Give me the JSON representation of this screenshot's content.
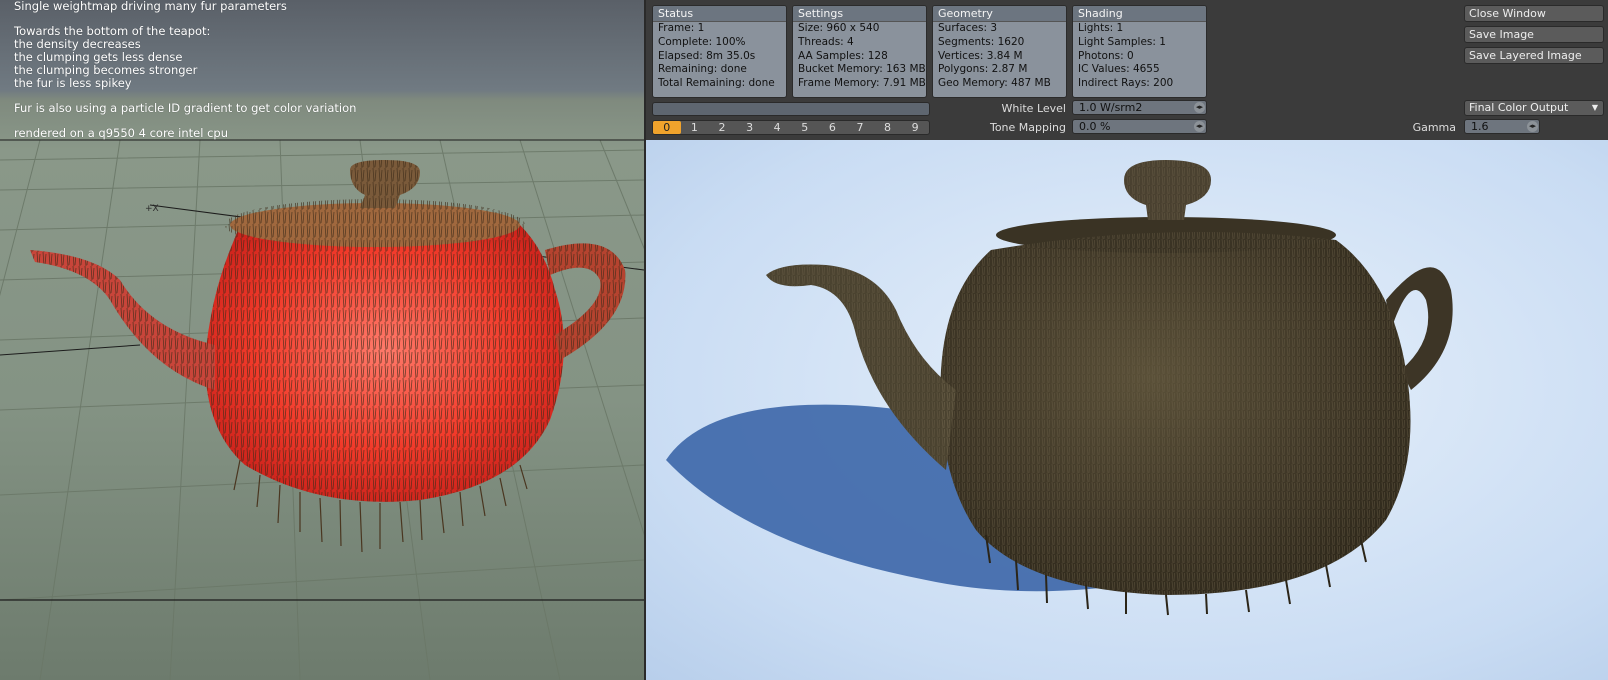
{
  "viewport": {
    "notes": [
      "Single weightmap driving many fur parameters",
      "",
      "Towards the bottom of the teapot:",
      "the density decreases",
      "the clumping gets less dense",
      "the clumping becomes stronger",
      "the fur is less spikey",
      "",
      "Fur is also using a particle ID gradient to get color variation",
      "",
      "rendered on a q9550 4 core intel cpu"
    ],
    "pivot_label": "+X"
  },
  "panels": {
    "status": {
      "title": "Status",
      "rows": [
        "Frame: 1",
        "Complete: 100%",
        "Elapsed: 8m 35.0s",
        "Remaining: done",
        "Total Remaining: done"
      ]
    },
    "settings": {
      "title": "Settings",
      "rows": [
        "Size: 960 x 540",
        "Threads: 4",
        "AA Samples: 128",
        "Bucket Memory: 163 MB",
        "Frame Memory: 7.91 MB"
      ]
    },
    "geometry": {
      "title": "Geometry",
      "rows": [
        "Surfaces: 3",
        "Segments: 1620",
        "Vertices: 3.84 M",
        "Polygons: 2.87 M",
        "Geo Memory: 487 MB"
      ]
    },
    "shading": {
      "title": "Shading",
      "rows": [
        "Lights: 1",
        "Light Samples: 1",
        "Photons: 0",
        "IC Values: 4655",
        "Indirect Rays: 200"
      ]
    }
  },
  "buttons": {
    "close": "Close Window",
    "save": "Save Image",
    "save_layered": "Save Layered Image"
  },
  "buffers": [
    "0",
    "1",
    "2",
    "3",
    "4",
    "5",
    "6",
    "7",
    "8",
    "9"
  ],
  "buffers_active": 0,
  "white_level": {
    "label": "White Level",
    "value": "1.0 W/srm2"
  },
  "tone_mapping": {
    "label": "Tone Mapping",
    "value": "0.0 %"
  },
  "output": {
    "selected": "Final Color Output"
  },
  "gamma": {
    "label": "Gamma",
    "value": "1.6"
  },
  "colors": {
    "panel_header": "#6c7580",
    "panel_body": "#8a929c",
    "active_buffer": "#f0a32c",
    "render_sky": "#cfe2f7",
    "fur": "#4a4232",
    "viewport_fur_base": "#ff3b2f"
  }
}
